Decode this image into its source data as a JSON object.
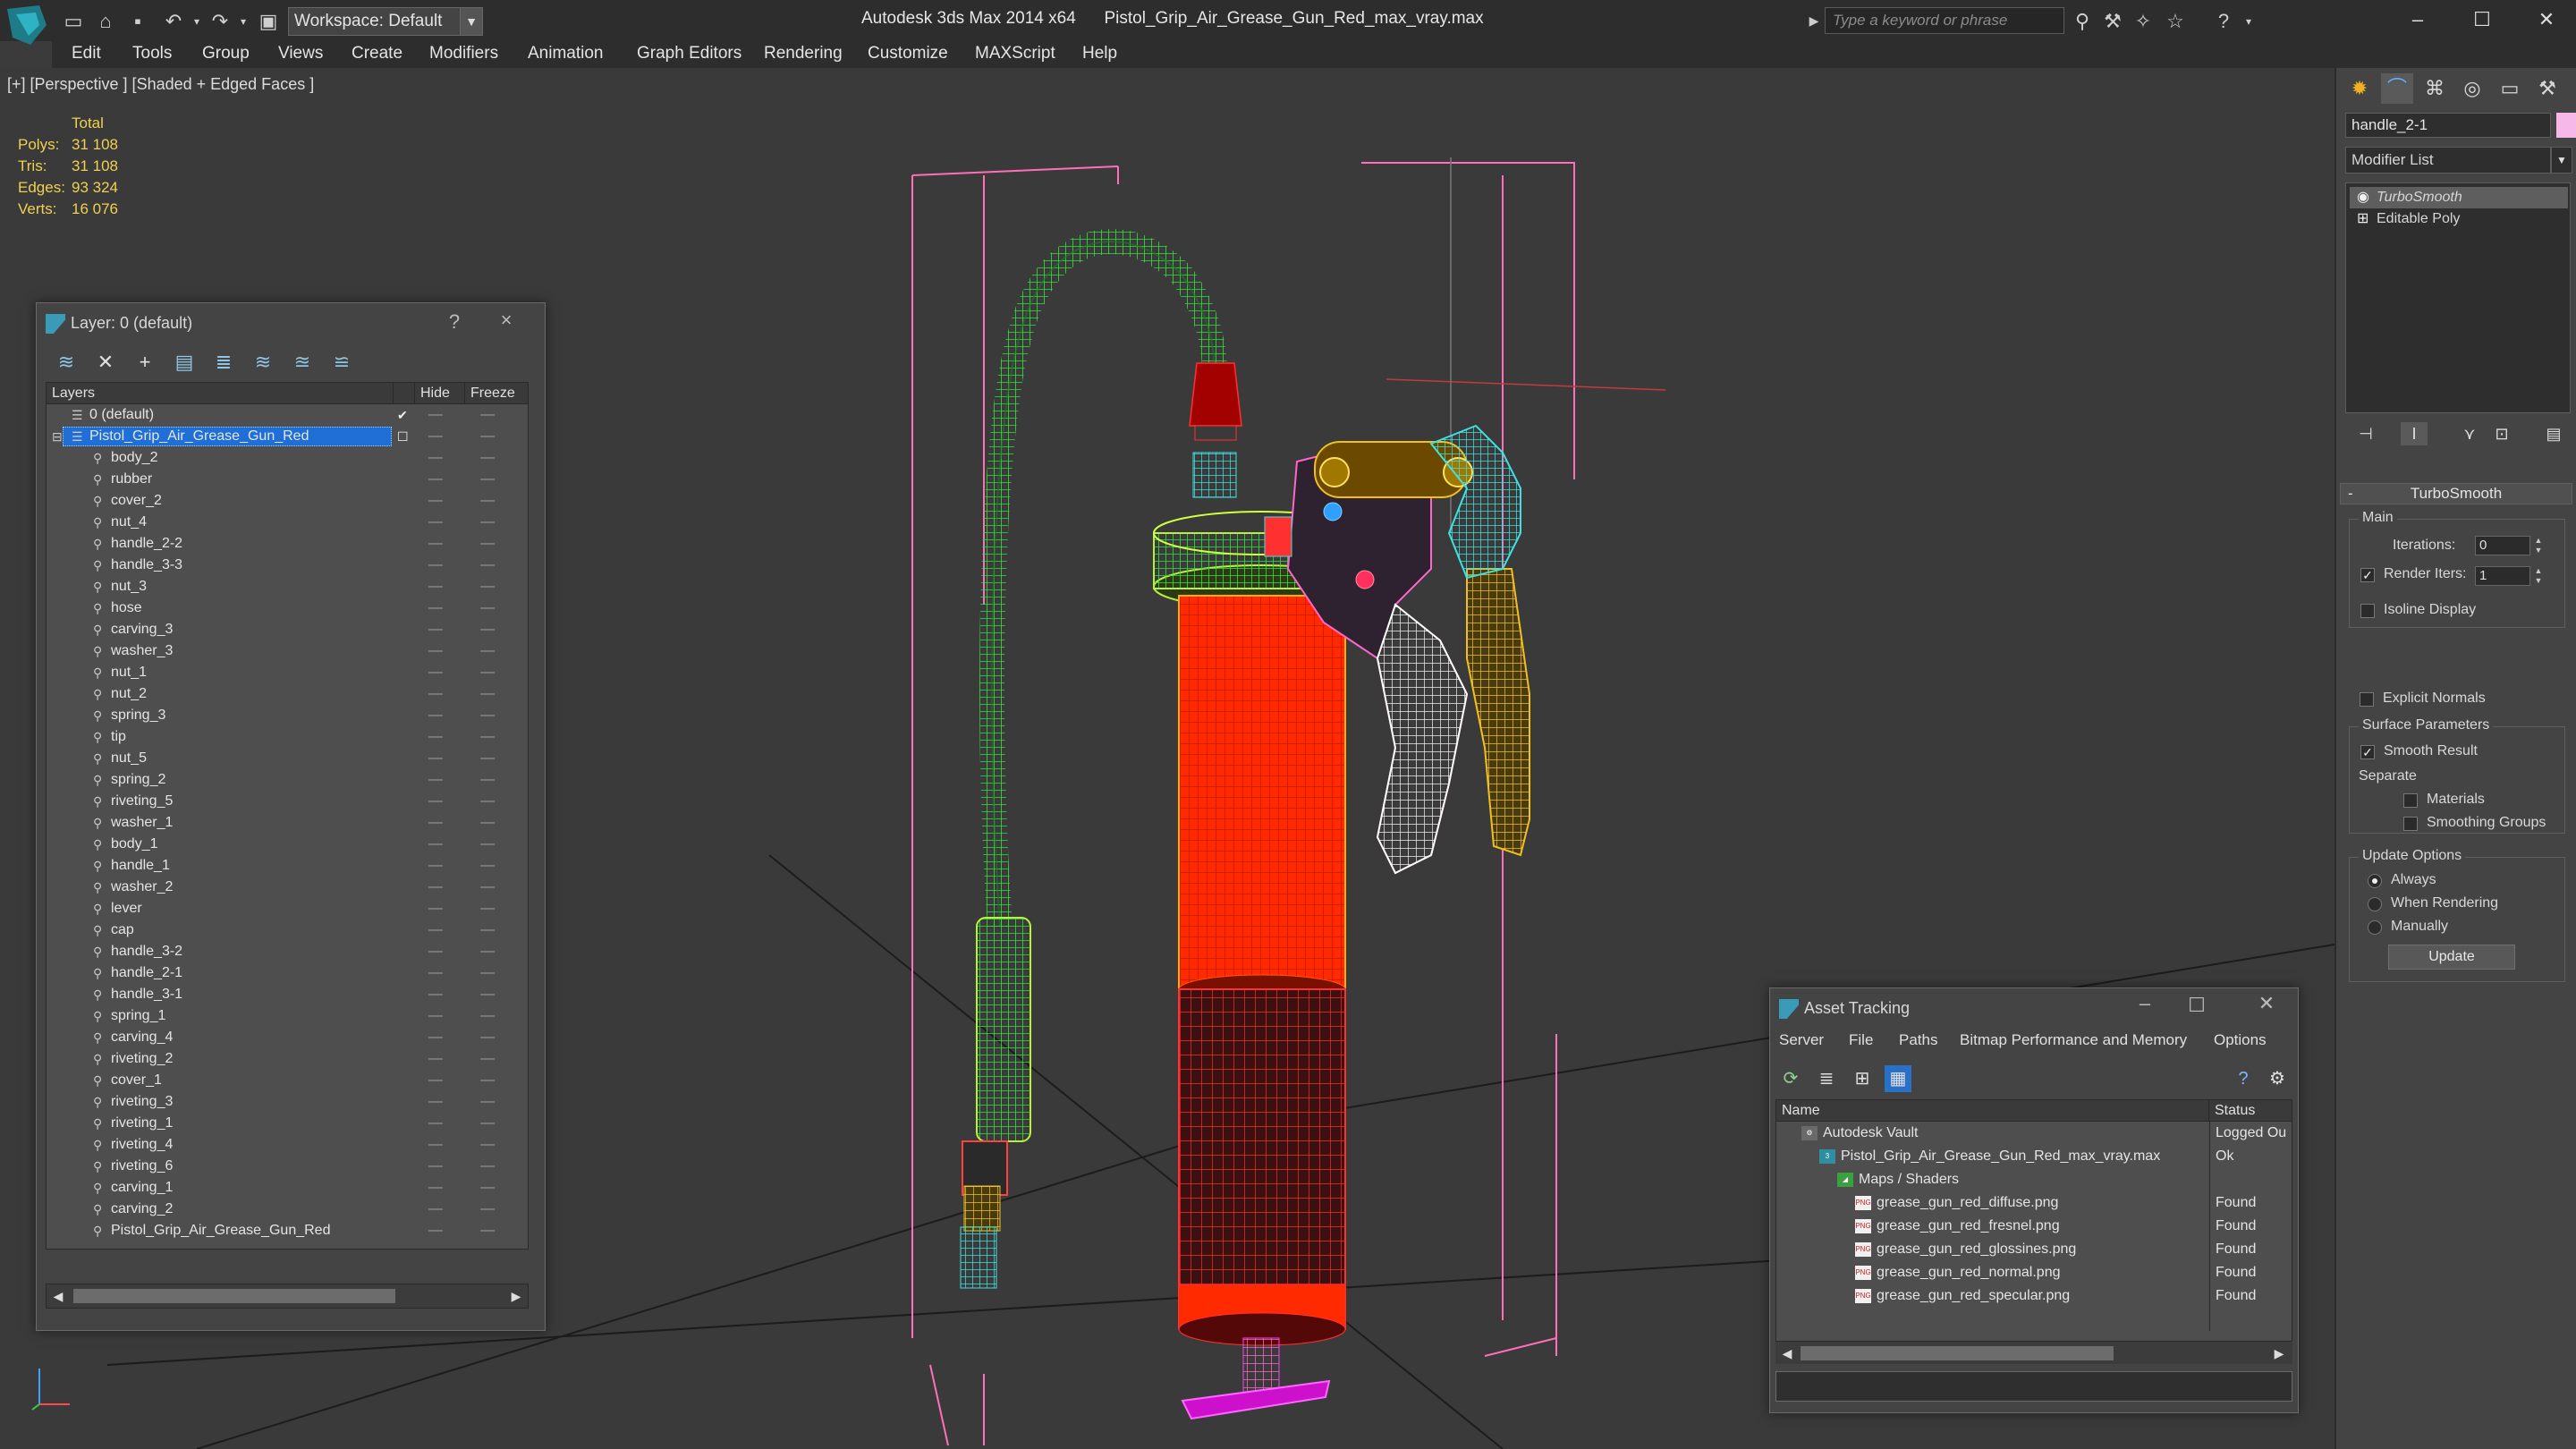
{
  "titlebar": {
    "workspace": "Workspace: Default",
    "app_title": "Autodesk 3ds Max 2014 x64",
    "file_title": "Pistol_Grip_Air_Grease_Gun_Red_max_vray.max",
    "search_placeholder": "Type a keyword or phrase"
  },
  "menu": [
    "Edit",
    "Tools",
    "Group",
    "Views",
    "Create",
    "Modifiers",
    "Animation",
    "Graph Editors",
    "Rendering",
    "Customize",
    "MAXScript",
    "Help"
  ],
  "viewport": {
    "label": "[+] [Perspective ] [Shaded + Edged Faces ]",
    "stats": {
      "header": "Total",
      "rows": [
        {
          "label": "Polys:",
          "value": "31 108"
        },
        {
          "label": "Tris:",
          "value": "31 108"
        },
        {
          "label": "Edges:",
          "value": "93 324"
        },
        {
          "label": "Verts:",
          "value": "16 076"
        }
      ]
    }
  },
  "layer_dialog": {
    "title": "Layer: 0 (default)",
    "help": "?",
    "close": "×",
    "columns": {
      "name": "Layers",
      "hide": "Hide",
      "freeze": "Freeze"
    },
    "default_layer": "0 (default)",
    "selected_layer": "Pistol_Grip_Air_Grease_Gun_Red",
    "objects": [
      "body_2",
      "rubber",
      "cover_2",
      "nut_4",
      "handle_2-2",
      "handle_3-3",
      "nut_3",
      "hose",
      "carving_3",
      "washer_3",
      "nut_1",
      "nut_2",
      "spring_3",
      "tip",
      "nut_5",
      "spring_2",
      "riveting_5",
      "washer_1",
      "body_1",
      "handle_1",
      "washer_2",
      "lever",
      "cap",
      "handle_3-2",
      "handle_2-1",
      "handle_3-1",
      "spring_1",
      "carving_4",
      "riveting_2",
      "cover_1",
      "riveting_3",
      "riveting_1",
      "riveting_4",
      "riveting_6",
      "carving_1",
      "carving_2",
      "Pistol_Grip_Air_Grease_Gun_Red"
    ]
  },
  "command_panel": {
    "object_name": "handle_2-1",
    "object_color": "#f5b8e8",
    "modifier_list": "Modifier List",
    "stack": [
      "TurboSmooth",
      "Editable Poly"
    ],
    "turbosmooth": {
      "title": "TurboSmooth",
      "main": "Main",
      "iterations_label": "Iterations:",
      "iterations": "0",
      "render_iters_label": "Render Iters:",
      "render_iters": "1",
      "render_iters_checked": true,
      "isoline": "Isoline Display",
      "explicit": "Explicit Normals",
      "surface": "Surface Parameters",
      "smooth_result": "Smooth Result",
      "smooth_result_checked": true,
      "separate": "Separate",
      "materials": "Materials",
      "smoothing_groups": "Smoothing Groups",
      "update_options": "Update Options",
      "always": "Always",
      "when_rendering": "When Rendering",
      "manually": "Manually",
      "selected_update": "Always",
      "update_button": "Update"
    }
  },
  "asset_dialog": {
    "title": "Asset Tracking",
    "menu": [
      "Server",
      "File",
      "Paths",
      "Bitmap Performance and Memory",
      "Options"
    ],
    "columns": {
      "name": "Name",
      "status": "Status"
    },
    "rows": [
      {
        "name": "Autodesk Vault",
        "status": "Logged Ou",
        "icon": "vault-icon"
      },
      {
        "name": "Pistol_Grip_Air_Grease_Gun_Red_max_vray.max",
        "status": "Ok",
        "icon": "max-file-icon"
      },
      {
        "name": "Maps / Shaders",
        "status": "",
        "icon": "maps-folder-icon"
      },
      {
        "name": "grease_gun_red_diffuse.png",
        "status": "Found",
        "icon": "png-icon"
      },
      {
        "name": "grease_gun_red_fresnel.png",
        "status": "Found",
        "icon": "png-icon"
      },
      {
        "name": "grease_gun_red_glossines.png",
        "status": "Found",
        "icon": "png-icon"
      },
      {
        "name": "grease_gun_red_normal.png",
        "status": "Found",
        "icon": "png-icon"
      },
      {
        "name": "grease_gun_red_specular.png",
        "status": "Found",
        "icon": "png-icon"
      }
    ]
  },
  "colors": {
    "selection": "#1f6fd6",
    "stats_yellow": "#f0d050",
    "cylinder_red": "#ff2a00",
    "wire_green": "#2fd43a",
    "wire_pink": "#ff66cc",
    "wire_cyan": "#40e0e0"
  }
}
